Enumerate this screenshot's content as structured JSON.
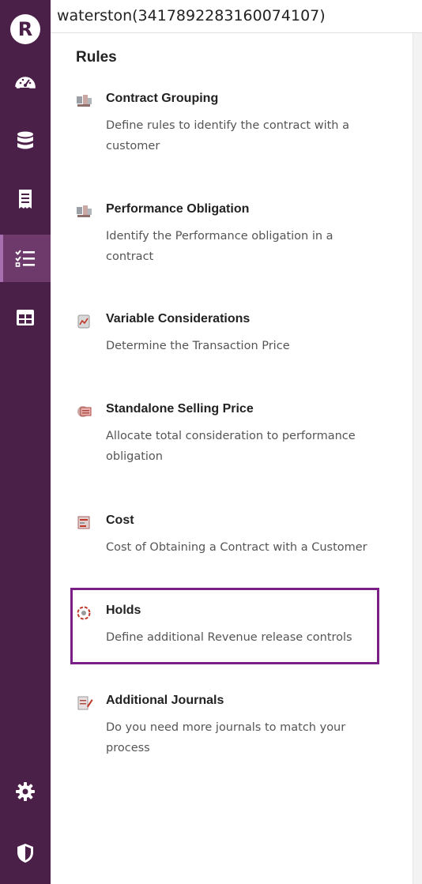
{
  "app": {
    "logo_letter": "R"
  },
  "search": {
    "value": "waterston(3417892283160074107)"
  },
  "sidebar": {
    "items": [
      {
        "name": "dashboard",
        "icon": "dashboard-gauge-icon"
      },
      {
        "name": "data",
        "icon": "database-icon"
      },
      {
        "name": "reports",
        "icon": "receipt-icon"
      },
      {
        "name": "rules",
        "icon": "checklist-icon",
        "active": true
      },
      {
        "name": "tables",
        "icon": "table-grid-icon"
      },
      {
        "name": "settings",
        "icon": "gear-icon"
      },
      {
        "name": "security",
        "icon": "shield-icon"
      }
    ],
    "colors": {
      "background": "#4a1f48",
      "active": "#6d3a6b",
      "icon": "#ffffff"
    }
  },
  "panel": {
    "title": "Rules",
    "rules": [
      {
        "title": "Contract Grouping",
        "description": "Define rules to identify the contract with a customer",
        "icon": "contract-grouping-icon"
      },
      {
        "title": "Performance Obligation",
        "description": "Identify the Performance obligation in a contract",
        "icon": "performance-obligation-icon"
      },
      {
        "title": "Variable Considerations",
        "description": "Determine the Transaction Price",
        "icon": "variable-considerations-icon"
      },
      {
        "title": "Standalone Selling Price",
        "description": "Allocate total consideration to performance obligation",
        "icon": "selling-price-icon"
      },
      {
        "title": "Cost",
        "description": "Cost of Obtaining a Contract with a Customer",
        "icon": "cost-icon"
      },
      {
        "title": "Holds",
        "description": "Define additional Revenue release controls",
        "icon": "holds-icon",
        "highlighted": true
      },
      {
        "title": "Additional Journals",
        "description": "Do you need more journals to match your process",
        "icon": "journals-icon"
      }
    ],
    "colors": {
      "highlight_border": "#7a1f85"
    }
  }
}
